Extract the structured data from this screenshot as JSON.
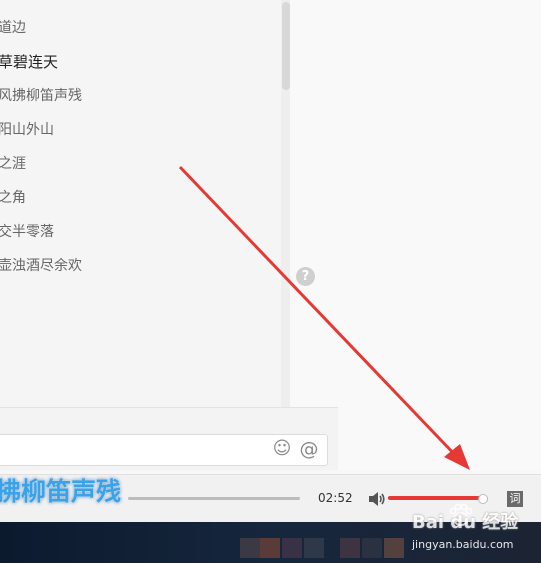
{
  "lyrics": {
    "lines": [
      {
        "text": "道边",
        "active": false
      },
      {
        "text": "草碧连天",
        "active": true
      },
      {
        "text": "风拂柳笛声残",
        "active": false
      },
      {
        "text": "阳山外山",
        "active": false
      },
      {
        "text": "之涯",
        "active": false
      },
      {
        "text": "之角",
        "active": false
      },
      {
        "text": "交半零落",
        "active": false
      },
      {
        "text": "壶浊酒尽余欢",
        "active": false
      }
    ]
  },
  "help": {
    "glyph": "?"
  },
  "comment": {
    "emoji_glyph": "☺",
    "at_glyph": "@",
    "placeholder": ""
  },
  "player": {
    "current_lyric": "拂柳笛声残",
    "time": "02:52",
    "volume_fraction": 0.93,
    "lyric_toggle_label": "词"
  },
  "watermark": {
    "text": "Bai du 经验",
    "sub": "jingyan.baidu.com"
  },
  "colors": {
    "accent_red": "#e53935",
    "lyric_blue": "#3aa2e8"
  },
  "icons": [
    "help-icon",
    "emoji-icon",
    "at-icon",
    "volume-icon",
    "lyrics-icon",
    "baidu-paw-icon"
  ]
}
